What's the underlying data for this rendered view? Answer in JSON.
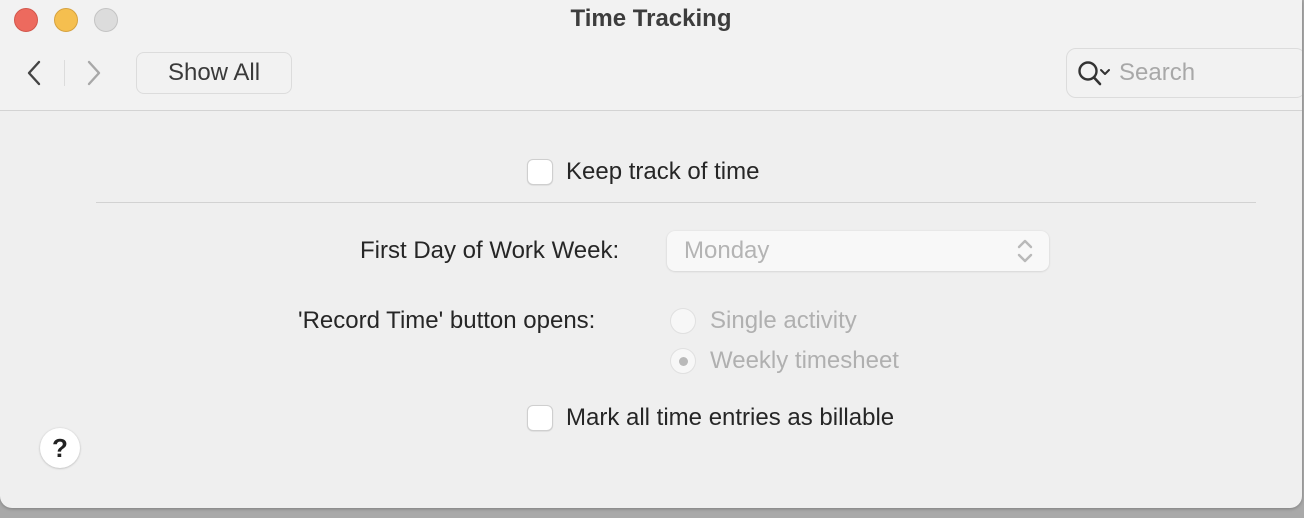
{
  "window": {
    "title": "Time Tracking",
    "traffic_lights": {
      "close_color": "#ed6a5e",
      "minimize_color": "#f5bf4f",
      "zoom_color": "#dcdcdc"
    }
  },
  "toolbar": {
    "back_icon": "chevron-left-icon",
    "forward_icon": "chevron-right-icon",
    "show_all_label": "Show All",
    "search": {
      "placeholder": "Search",
      "value": "",
      "icon": "search-icon"
    }
  },
  "settings": {
    "keep_track": {
      "label": "Keep track of time",
      "checked": false
    },
    "first_day": {
      "label": "First Day of Work Week:",
      "value": "Monday",
      "enabled": false
    },
    "record_time": {
      "label": "'Record Time' button opens:",
      "options": [
        {
          "label": "Single activity",
          "selected": false
        },
        {
          "label": "Weekly timesheet",
          "selected": true
        }
      ],
      "enabled": false
    },
    "billable": {
      "label": "Mark all time entries as billable",
      "checked": false
    }
  },
  "help": {
    "label": "?"
  }
}
